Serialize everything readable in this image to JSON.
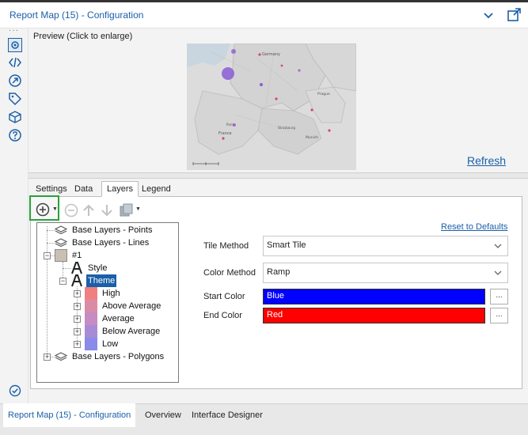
{
  "window": {
    "title": "Report Map (15) - Configuration"
  },
  "preview": {
    "label": "Preview (Click to enlarge)",
    "refresh": "Refresh",
    "map_labels": [
      "Germany",
      "Prague",
      "France",
      "Strasbourg",
      "Munich",
      "Paris"
    ]
  },
  "tabs": [
    {
      "label": "Settings",
      "active": false
    },
    {
      "label": "Data",
      "active": false
    },
    {
      "label": "Layers",
      "active": true
    },
    {
      "label": "Legend",
      "active": false
    }
  ],
  "tree": {
    "base_points": "Base Layers - Points",
    "base_lines": "Base Layers - Lines",
    "layer1": "#1",
    "style": "Style",
    "theme": "Theme",
    "classes": [
      {
        "label": "High",
        "color": "#f08080"
      },
      {
        "label": "Above Average",
        "color": "#d98ca6"
      },
      {
        "label": "Average",
        "color": "#c68bc2"
      },
      {
        "label": "Below Average",
        "color": "#a88bd6"
      },
      {
        "label": "Low",
        "color": "#8a8ae8"
      }
    ],
    "base_polygons": "Base Layers - Polygons"
  },
  "props": {
    "reset": "Reset to Defaults",
    "tile_method_label": "Tile Method",
    "tile_method_value": "Smart Tile",
    "color_method_label": "Color Method",
    "color_method_value": "Ramp",
    "start_color_label": "Start Color",
    "start_color_value": "Blue",
    "start_color_hex": "#0000ff",
    "end_color_label": "End Color",
    "end_color_value": "Red",
    "end_color_hex": "#ff0000",
    "dots": "..."
  },
  "bottom_tabs": [
    {
      "label": "Report Map (15) - Configuration",
      "active": true
    },
    {
      "label": "Overview",
      "active": false
    },
    {
      "label": "Interface Designer",
      "active": false
    }
  ],
  "colors": {
    "accent": "#1b5fa8",
    "highlight_green": "#2aa13c"
  }
}
